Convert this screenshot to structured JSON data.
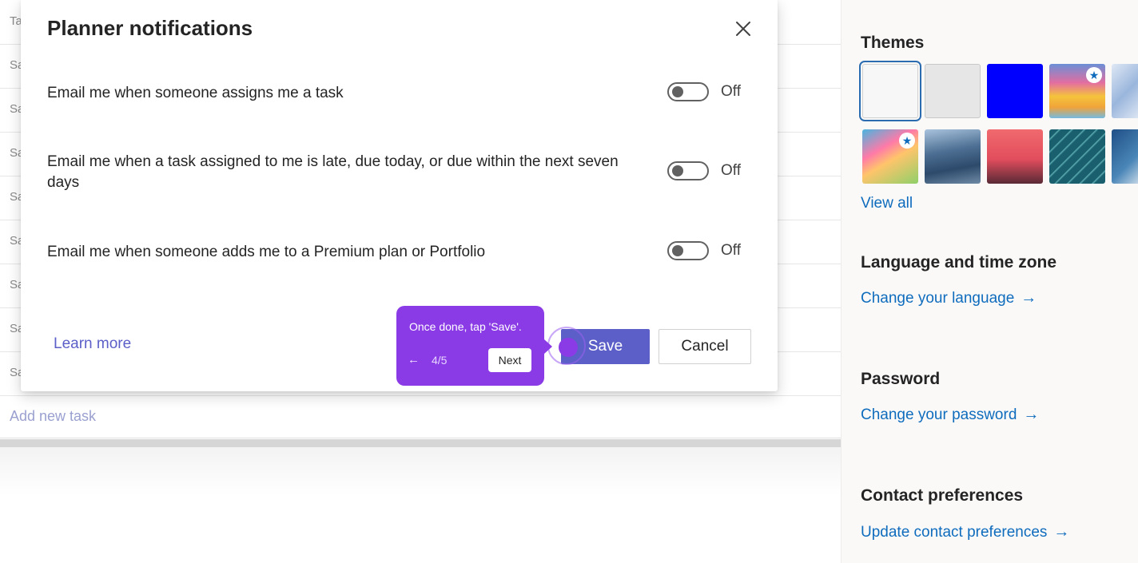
{
  "background": {
    "first_row_partial": "Ta",
    "task_rows": [
      "Sa",
      "Sa",
      "Sa",
      "Sa",
      "Sa",
      "Sa",
      "Sa",
      "Sa"
    ],
    "add_task_label": "Add new task"
  },
  "dialog": {
    "title": "Planner notifications",
    "close_icon": "close-icon",
    "settings": [
      {
        "label": "Email me when someone assigns me a task",
        "state": "Off"
      },
      {
        "label": "Email me when a task assigned to me is late, due today, or due within the next seven days",
        "state": "Off"
      },
      {
        "label": "Email me when someone adds me to a Premium plan or Portfolio",
        "state": "Off"
      }
    ],
    "learn_more": "Learn more",
    "save_label": "Save",
    "cancel_label": "Cancel"
  },
  "guide": {
    "text": "Once done, tap 'Save'.",
    "back_icon": "arrow-left-icon",
    "back_glyph": "←",
    "step": "4/5",
    "next_label": "Next"
  },
  "settings_panel": {
    "themes_heading": "Themes",
    "themes": [
      {
        "name": "white",
        "color": "#f7f7f7",
        "selected": true
      },
      {
        "name": "light-gray",
        "color": "#e6e6e6"
      },
      {
        "name": "blue",
        "color": "#0000ff"
      },
      {
        "name": "rainbow",
        "color": "#f0c040",
        "starred": true
      },
      {
        "name": "colorful-art",
        "color": "#ff7aa8",
        "starred": true
      },
      {
        "name": "mountain-blue",
        "color": "#3b5f86"
      },
      {
        "name": "palm-sunset",
        "color": "#e0505a"
      },
      {
        "name": "circuit-teal",
        "color": "#1f6f80"
      }
    ],
    "view_all": "View all",
    "language_heading": "Language and time zone",
    "language_link": "Change your language",
    "password_heading": "Password",
    "password_link": "Change your password",
    "contact_heading": "Contact preferences",
    "contact_link": "Update contact preferences",
    "arrow_glyph": "→",
    "star_glyph": "★"
  },
  "colors": {
    "accent": "#5b5fc7",
    "link": "#0f6cbd",
    "guide": "#8b3be6"
  }
}
